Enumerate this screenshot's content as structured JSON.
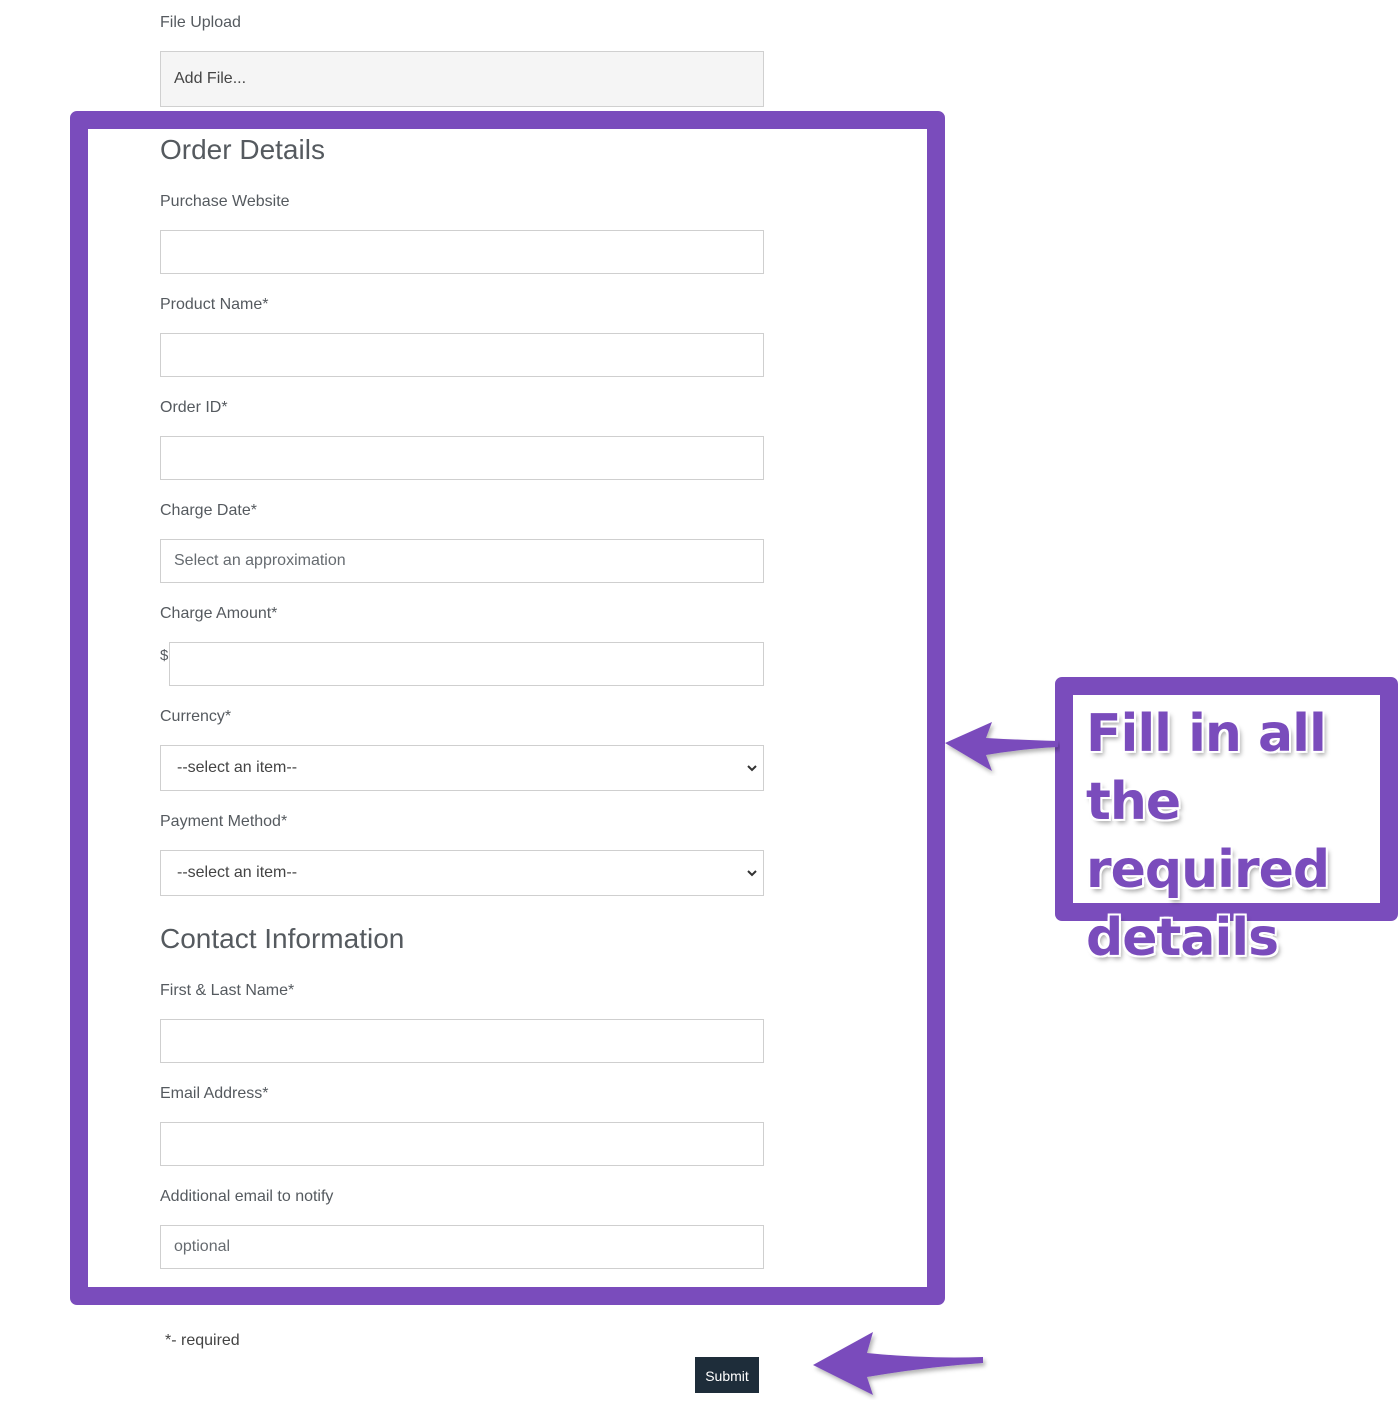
{
  "file_upload": {
    "label": "File Upload",
    "button_label": "Add File..."
  },
  "order_details": {
    "heading": "Order Details",
    "purchase_website": {
      "label": "Purchase Website",
      "value": "",
      "placeholder": ""
    },
    "product_name": {
      "label": "Product Name*",
      "value": "",
      "placeholder": ""
    },
    "order_id": {
      "label": "Order ID*",
      "value": "",
      "placeholder": ""
    },
    "charge_date": {
      "label": "Charge Date*",
      "placeholder": "Select an approximation"
    },
    "charge_amount": {
      "label": "Charge Amount*",
      "currency_symbol": "$",
      "value": ""
    },
    "currency": {
      "label": "Currency*",
      "selected": "--select an item--"
    },
    "payment_method": {
      "label": "Payment Method*",
      "selected": "--select an item--"
    }
  },
  "contact_information": {
    "heading": "Contact Information",
    "name": {
      "label": "First & Last Name*",
      "value": ""
    },
    "email": {
      "label": "Email Address*",
      "value": ""
    },
    "additional_email": {
      "label": "Additional email to notify",
      "placeholder": "optional"
    }
  },
  "footer": {
    "required_note": "*- required",
    "submit_label": "Submit"
  },
  "annotation": {
    "callout_text": "Fill in all the required details",
    "accent_color": "#7a4cbc"
  }
}
